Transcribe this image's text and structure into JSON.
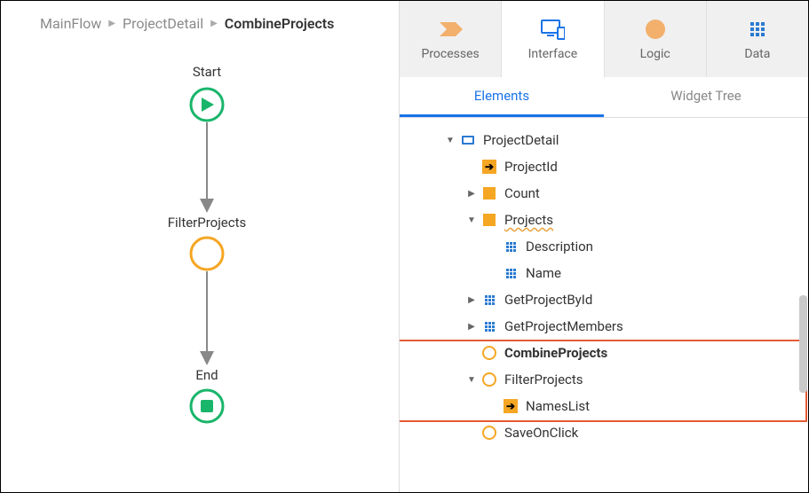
{
  "breadcrumb": {
    "items": [
      "MainFlow",
      "ProjectDetail",
      "CombineProjects"
    ]
  },
  "flow": {
    "nodes": {
      "start": "Start",
      "filter": "FilterProjects",
      "end": "End"
    }
  },
  "topTabs": {
    "processes": "Processes",
    "interface": "Interface",
    "logic": "Logic",
    "data": "Data"
  },
  "subTabs": {
    "elements": "Elements",
    "widgetTree": "Widget Tree"
  },
  "tree": {
    "root": "ProjectDetail",
    "projectId": "ProjectId",
    "count": "Count",
    "projects": "Projects",
    "description": "Description",
    "name": "Name",
    "getProjectById": "GetProjectById",
    "getProjectMembers": "GetProjectMembers",
    "combineProjects": "CombineProjects",
    "filterProjects": "FilterProjects",
    "namesList": "NamesList",
    "saveOnClick": "SaveOnClick"
  }
}
